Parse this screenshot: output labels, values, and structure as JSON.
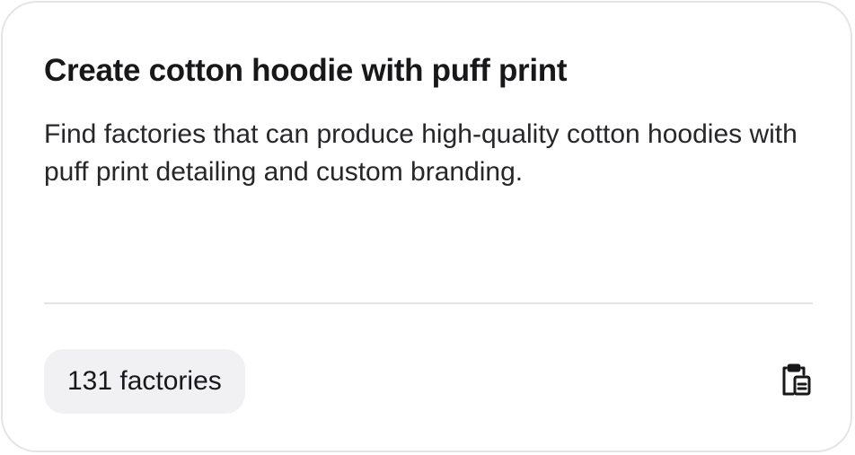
{
  "card": {
    "title": "Create cotton hoodie with puff print",
    "description": "Find factories that can produce high-quality cotton hoodies with puff print detailing and custom branding.",
    "factory_count_label": "131 factories",
    "copy_icon": "clipboard-copy-icon"
  },
  "colors": {
    "border": "#e4e4e7",
    "text": "#18181b",
    "badge_bg": "#f1f1f4"
  }
}
